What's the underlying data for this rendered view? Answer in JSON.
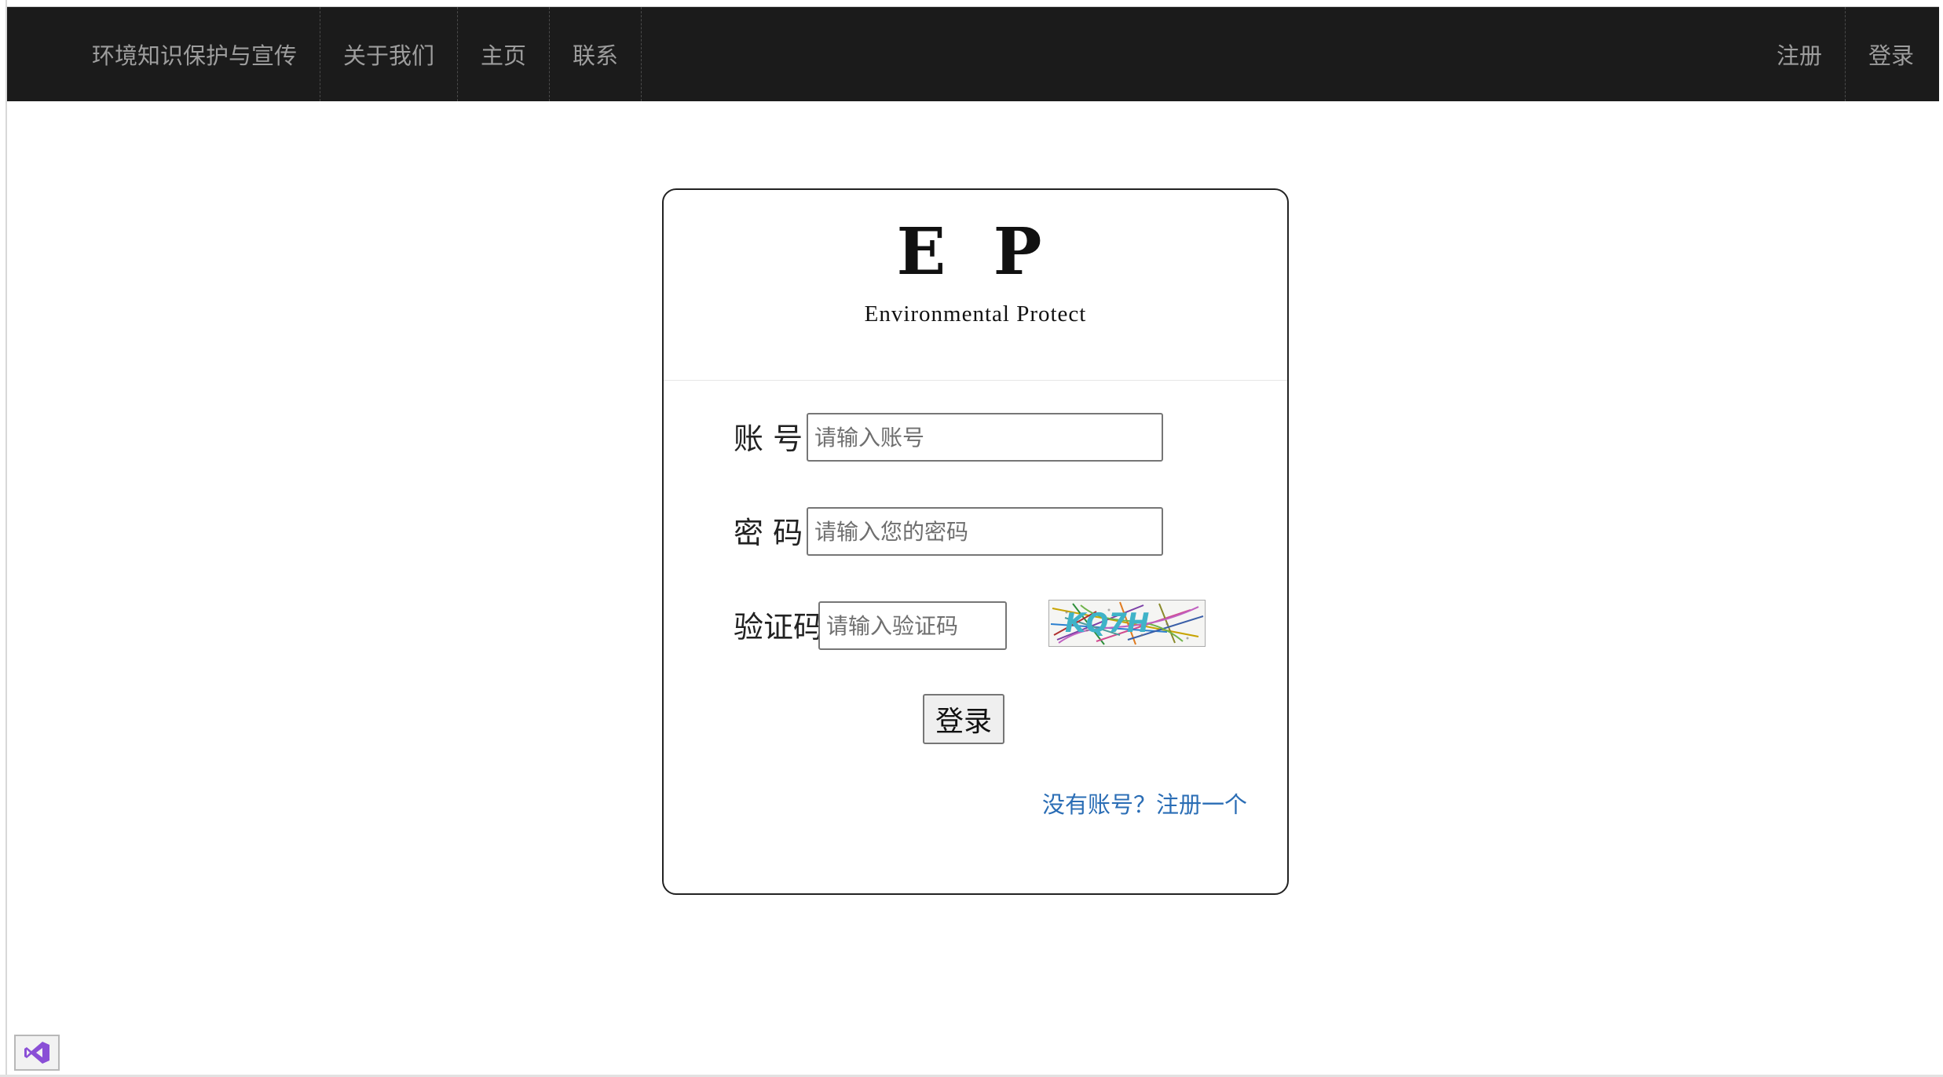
{
  "navbar": {
    "brand": "环境知识保护与宣传",
    "links": [
      "关于我们",
      "主页",
      "联系"
    ],
    "right_links": [
      "注册",
      "登录"
    ],
    "background": "#1b1b1b",
    "text_color": "#9d9d9d"
  },
  "logo": {
    "title": "E P",
    "subtitle": "Environmental Protect"
  },
  "form": {
    "account_label": "账 号",
    "account_placeholder": "请输入账号",
    "password_label": "密 码",
    "password_placeholder": "请输入您的密码",
    "captcha_label": "验证码",
    "captcha_placeholder": "请输入验证码",
    "captcha_text": "KQ7H",
    "login_button": "登录",
    "register_link": "没有账号？注册一个"
  },
  "colors": {
    "link": "#2a6db5",
    "card_border": "#222222"
  },
  "icons": {
    "vs_badge": "visual-studio-icon"
  }
}
